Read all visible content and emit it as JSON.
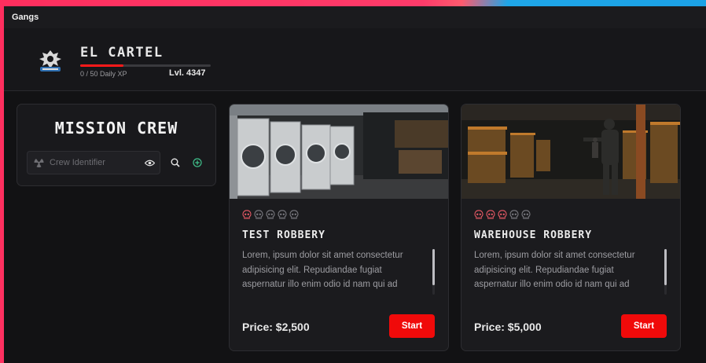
{
  "window": {
    "title": "Gangs"
  },
  "gang": {
    "name": "EL CARTEL",
    "xp_text": "0 / 50 Daily XP",
    "xp_progress": 0.33,
    "level": "Lvl. 4347"
  },
  "crew": {
    "title": "MISSION CREW",
    "input_placeholder": "Crew Identifier"
  },
  "missions": [
    {
      "title": "TEST ROBBERY",
      "description": "Lorem, ipsum dolor sit amet consectetur adipisicing elit. Repudiandae fugiat aspernatur illo enim odio id nam qui ad",
      "price": "Price: $2,500",
      "start_label": "Start",
      "difficulty": 1,
      "difficulty_max": 5
    },
    {
      "title": "WAREHOUSE ROBBERY",
      "description": "Lorem, ipsum dolor sit amet consectetur adipisicing elit. Repudiandae fugiat aspernatur illo enim odio id nam qui ad",
      "price": "Price: $5,000",
      "start_label": "Start",
      "difficulty": 3,
      "difficulty_max": 5
    }
  ],
  "colors": {
    "accent": "#f00a0a",
    "skull_active": "#e85a66",
    "skull_inactive": "#7a7a80"
  }
}
